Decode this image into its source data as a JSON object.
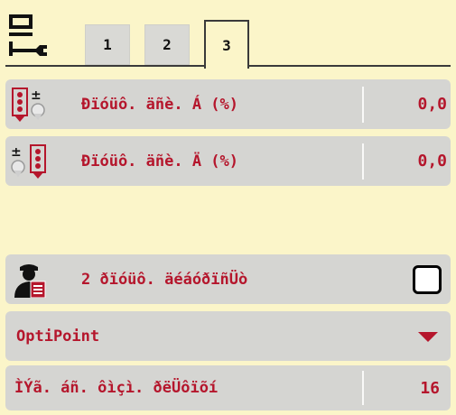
{
  "header": {
    "settings_icon": "wrench-settings-icon",
    "tabs": [
      {
        "label": "1",
        "active": false
      },
      {
        "label": "2",
        "active": false
      },
      {
        "label": "3",
        "active": true
      }
    ]
  },
  "rows": {
    "row_a": {
      "icon": "boundary-quantity-left-icon",
      "label": "Ðïóüô. äñè. Á (%)",
      "value": "0,0"
    },
    "row_b": {
      "icon": "boundary-quantity-right-icon",
      "label": "Ðïóüô. äñè. Ä (%)",
      "value": "0,0"
    },
    "operator_row": {
      "icon": "operator-report-icon",
      "label": "2 ðïóüô. äéáóðïñÜò",
      "checked": false
    },
    "select": {
      "value": "OptiPoint",
      "icon": "dropdown-arrow-icon"
    },
    "last_row": {
      "label": "ÌÝã. áñ. ôìçì. ðëÜôïõí",
      "value": "16"
    }
  },
  "colors": {
    "background": "#fbf5c9",
    "row_background": "#d5d5d2",
    "text_accent": "#b5162c"
  }
}
